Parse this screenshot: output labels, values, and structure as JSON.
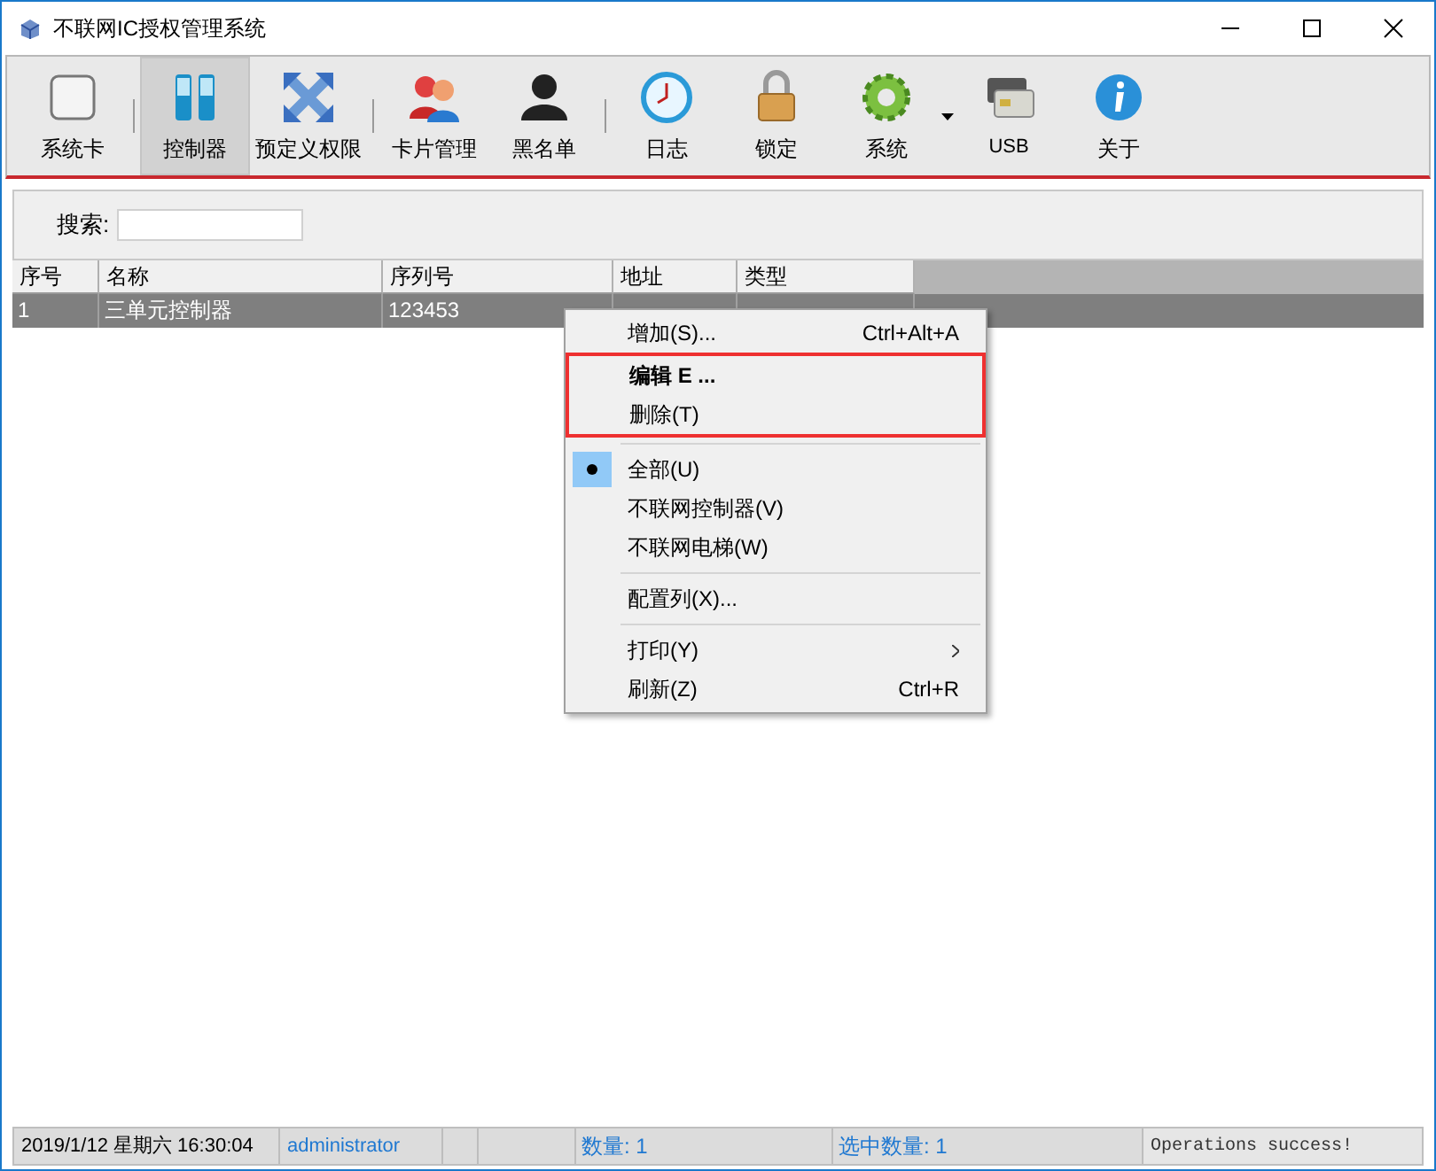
{
  "window": {
    "title": "不联网IC授权管理系统"
  },
  "toolbar": [
    {
      "kind": "button",
      "label": "系统卡",
      "selected": false
    },
    {
      "kind": "separator"
    },
    {
      "kind": "button",
      "label": "控制器",
      "selected": true
    },
    {
      "kind": "button",
      "label": "预定义权限",
      "selected": false
    },
    {
      "kind": "separator"
    },
    {
      "kind": "button",
      "label": "卡片管理",
      "selected": false
    },
    {
      "kind": "button",
      "label": "黑名单",
      "selected": false
    },
    {
      "kind": "separator"
    },
    {
      "kind": "button",
      "label": "日志",
      "selected": false
    },
    {
      "kind": "button",
      "label": "锁定",
      "selected": false
    },
    {
      "kind": "button",
      "label": "系统",
      "selected": false
    },
    {
      "kind": "dropdown"
    },
    {
      "kind": "button",
      "label": "USB",
      "selected": false
    },
    {
      "kind": "button",
      "label": "关于",
      "selected": false
    }
  ],
  "search": {
    "label": "搜索:"
  },
  "table": {
    "columns": [
      "序号",
      "名称",
      "序列号",
      "地址",
      "类型"
    ],
    "rows": [
      {
        "cells": [
          "1",
          "三单元控制器",
          "123453",
          "",
          ""
        ],
        "selected": true
      }
    ]
  },
  "context_menu": [
    {
      "kind": "item",
      "label": "增加(S)...",
      "shortcut": "Ctrl+Alt+A",
      "default": false,
      "highlighted": false
    },
    {
      "kind": "item",
      "label": "编辑 E ...",
      "default": true,
      "highlighted": true
    },
    {
      "kind": "item",
      "label": "删除(T)",
      "default": false,
      "highlighted": true
    },
    {
      "kind": "separator"
    },
    {
      "kind": "radio",
      "label": "全部(U)",
      "selected": true
    },
    {
      "kind": "radio",
      "label": "不联网控制器(V)",
      "selected": false
    },
    {
      "kind": "radio",
      "label": "不联网电梯(W)",
      "selected": false
    },
    {
      "kind": "separator"
    },
    {
      "kind": "item",
      "label": "配置列(X)...",
      "default": false,
      "highlighted": false
    },
    {
      "kind": "separator"
    },
    {
      "kind": "submenu",
      "label": "打印(Y)"
    },
    {
      "kind": "item",
      "label": "刷新(Z)",
      "shortcut": "Ctrl+R",
      "default": false,
      "highlighted": false
    }
  ],
  "status_bar": {
    "datetime": "2019/1/12 星期六 16:30:04",
    "user": "administrator",
    "count": "数量: 1",
    "selected_count": "选中数量: 1",
    "message": "Operations success!"
  }
}
